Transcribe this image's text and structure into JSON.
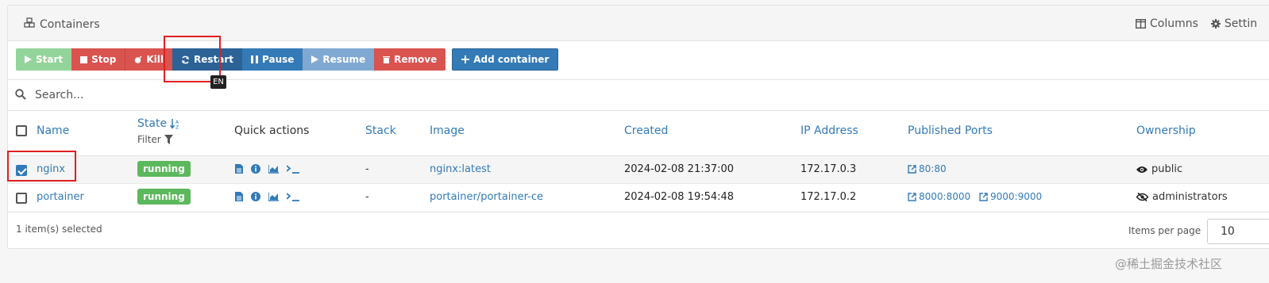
{
  "header": {
    "title": "Containers",
    "columns_label": "Columns",
    "settings_label": "Settin"
  },
  "toolbar": {
    "start": "Start",
    "stop": "Stop",
    "kill": "Kill",
    "restart": "Restart",
    "pause": "Pause",
    "resume": "Resume",
    "remove": "Remove",
    "add": "Add container",
    "tooltip": "EN"
  },
  "search": {
    "placeholder": "Search..."
  },
  "columns": {
    "name": "Name",
    "state": "State",
    "filter": "Filter",
    "quick_actions": "Quick actions",
    "stack": "Stack",
    "image": "Image",
    "created": "Created",
    "ip": "IP Address",
    "ports": "Published Ports",
    "ownership": "Ownership"
  },
  "rows": [
    {
      "selected": true,
      "name": "nginx",
      "state": "running",
      "stack": "-",
      "image": "nginx:latest",
      "created": "2024-02-08 21:37:00",
      "ip": "172.17.0.3",
      "ports": [
        "80:80"
      ],
      "ownership": "public"
    },
    {
      "selected": false,
      "name": "portainer",
      "state": "running",
      "stack": "-",
      "image": "portainer/portainer-ce",
      "created": "2024-02-08 19:54:48",
      "ip": "172.17.0.2",
      "ports": [
        "8000:8000",
        "9000:9000"
      ],
      "ownership": "administrators"
    }
  ],
  "footer": {
    "selected_text": "1 item(s) selected",
    "items_per_page_label": "Items per page",
    "items_per_page_value": "10"
  },
  "watermark": "@稀土掘金技术社区",
  "colors": {
    "accent": "#337ab7",
    "danger": "#d9534f",
    "success": "#5cb85c",
    "highlight": "#e02020"
  }
}
